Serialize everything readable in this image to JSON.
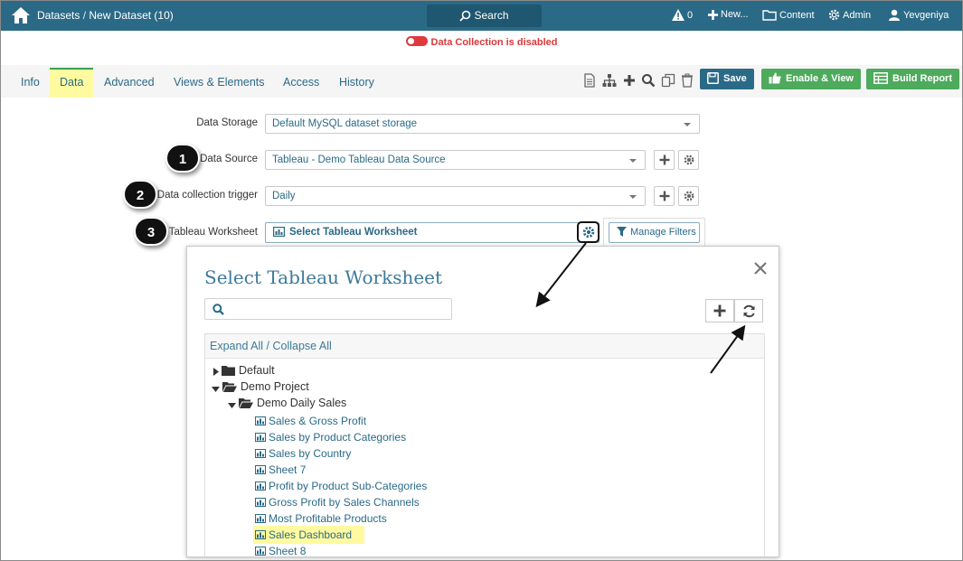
{
  "topbar": {
    "breadcrumb_root": "Datasets",
    "breadcrumb_sep": " / ",
    "breadcrumb_current": "New Dataset (10)",
    "search_label": "Search",
    "alerts_count": "0",
    "new_label": "New...",
    "content_label": "Content",
    "admin_label": "Admin",
    "user_label": "Yevgeniya"
  },
  "status": {
    "text": "Data Collection is disabled",
    "toggle_color": "#e0393d"
  },
  "tabs": [
    {
      "label": "Info"
    },
    {
      "label": "Data"
    },
    {
      "label": "Advanced"
    },
    {
      "label": "Views & Elements"
    },
    {
      "label": "Access"
    },
    {
      "label": "History"
    }
  ],
  "toolbar": {
    "save_label": "Save",
    "enable_view_label": "Enable & View",
    "build_report_label": "Build Report",
    "icons": [
      "document-icon",
      "sitemap-icon",
      "plus-icon",
      "search-icon",
      "copy-icon",
      "trash-icon"
    ]
  },
  "form": {
    "data_storage": {
      "label": "Data Storage",
      "value": "Default MySQL dataset storage"
    },
    "data_source": {
      "label": "Data Source",
      "value": "Tableau - Demo Tableau Data Source"
    },
    "trigger": {
      "label": "Data collection trigger",
      "value": "Daily"
    },
    "worksheet": {
      "label": "Tableau Worksheet",
      "value": "Select Tableau Worksheet",
      "manage_filters": "Manage Filters"
    }
  },
  "badges": [
    "1",
    "2",
    "3"
  ],
  "modal": {
    "title": "Select Tableau Worksheet",
    "search_placeholder": "",
    "expand_all": "Expand All",
    "sep": " / ",
    "collapse_all": "Collapse All",
    "tree": {
      "default_folder": "Default",
      "demo_project": "Demo Project",
      "demo_daily_sales": "Demo Daily Sales",
      "worksheets": [
        "Sales & Gross Profit",
        "Sales by Product Categories",
        "Sales by Country",
        "Sheet 7",
        "Profit by Product Sub-Categories",
        "Gross Profit by Sales Channels",
        "Most Profitable Products",
        "Sales Dashboard",
        "Sheet 8"
      ],
      "highlighted_index": 7
    }
  },
  "colors": {
    "topbar": "#2b6a87",
    "accent": "#2b6a87",
    "success": "#4eaa5c",
    "highlight": "#fffaa0",
    "danger": "#d9383a"
  }
}
